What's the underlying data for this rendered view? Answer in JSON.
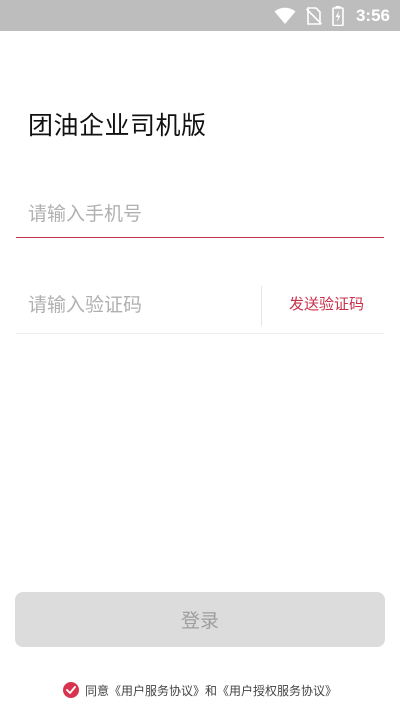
{
  "status_bar": {
    "time": "3:56",
    "icons": [
      "wifi-icon",
      "no-sim-icon",
      "battery-charging-icon"
    ]
  },
  "app": {
    "title": "团油企业司机版"
  },
  "form": {
    "phone_placeholder": "请输入手机号",
    "phone_value": "",
    "code_placeholder": "请输入验证码",
    "code_value": "",
    "send_code_label": "发送验证码",
    "login_label": "登录"
  },
  "agreement": {
    "text": "同意《用户服务协议》和《用户授权服务协议》",
    "checked": true
  },
  "colors": {
    "accent": "#c8314a",
    "status_bar_bg": "#bdbdbd",
    "login_disabled_bg": "#dcdcdc",
    "login_disabled_text": "#9e9e9e"
  }
}
